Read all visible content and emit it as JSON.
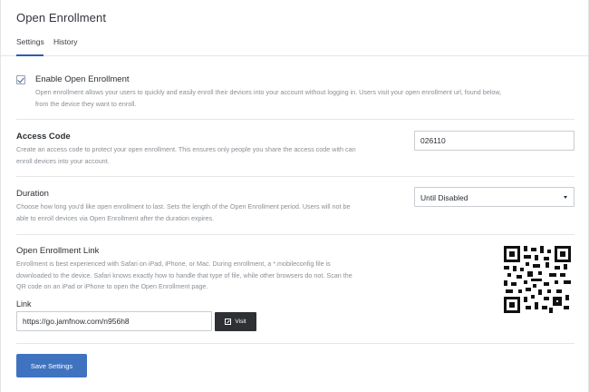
{
  "page": {
    "title": "Open Enrollment"
  },
  "tabs": [
    {
      "label": "Settings",
      "active": true
    },
    {
      "label": "History",
      "active": false
    }
  ],
  "enable": {
    "checked": true,
    "label": "Enable Open Enrollment",
    "description_line1": "Open enrollment allows your users to quickly and easily enroll their devices into your account without logging in. Users visit your open enrollment url, found below,",
    "description_line2": "from the device they want to enroll."
  },
  "access_code": {
    "label": "Access Code",
    "description_line1": "Create an access code to protect your open enrollment. This ensures only people you share the access code with can",
    "description_line2": "enroll devices into your account.",
    "value": "026110"
  },
  "duration": {
    "label": "Duration",
    "description_line1": "Choose how long you'd like open enrollment to last. Sets the length of the Open Enrollment period. Users will not be",
    "description_line2": "able to enroll devices via Open Enrollment after the duration expires.",
    "selected": "Until Disabled"
  },
  "link_section": {
    "label": "Open Enrollment Link",
    "description_line1": "Enrollment is best experienced with Safari on iPad, iPhone, or Mac. During enrollment, a *.mobileconfig file is",
    "description_line2": "downloaded to the device. Safari knows exactly how to handle that type of file, while other browsers do not. Scan the",
    "description_line3": "QR code on an iPad or iPhone to open the Open Enrollment page.",
    "link_label": "Link",
    "link_value": "https://go.jamfnow.com/n956h8",
    "visit_label": "Visit",
    "qr_icon": "qr-code"
  },
  "footer": {
    "save_label": "Save Settings"
  },
  "colors": {
    "accent": "#3f73c0",
    "tab_underline": "#2d5ea8",
    "dark_button": "#2e3034"
  }
}
